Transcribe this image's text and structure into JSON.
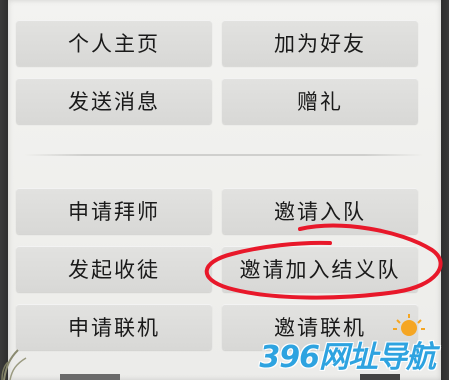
{
  "menu": {
    "top": [
      {
        "label": "个人主页"
      },
      {
        "label": "加为好友"
      },
      {
        "label": "发送消息"
      },
      {
        "label": "赠礼"
      }
    ],
    "bottom": [
      {
        "label": "申请拜师"
      },
      {
        "label": "邀请入队"
      },
      {
        "label": "发起收徒"
      },
      {
        "label": "邀请加入结义队"
      },
      {
        "label": "申请联机"
      },
      {
        "label": "邀请联机"
      }
    ]
  },
  "annotation": {
    "color": "#e8182a",
    "target": "邀请加入结义队"
  },
  "watermark": {
    "text": "396网址导航",
    "color": "#2ea3e0"
  }
}
